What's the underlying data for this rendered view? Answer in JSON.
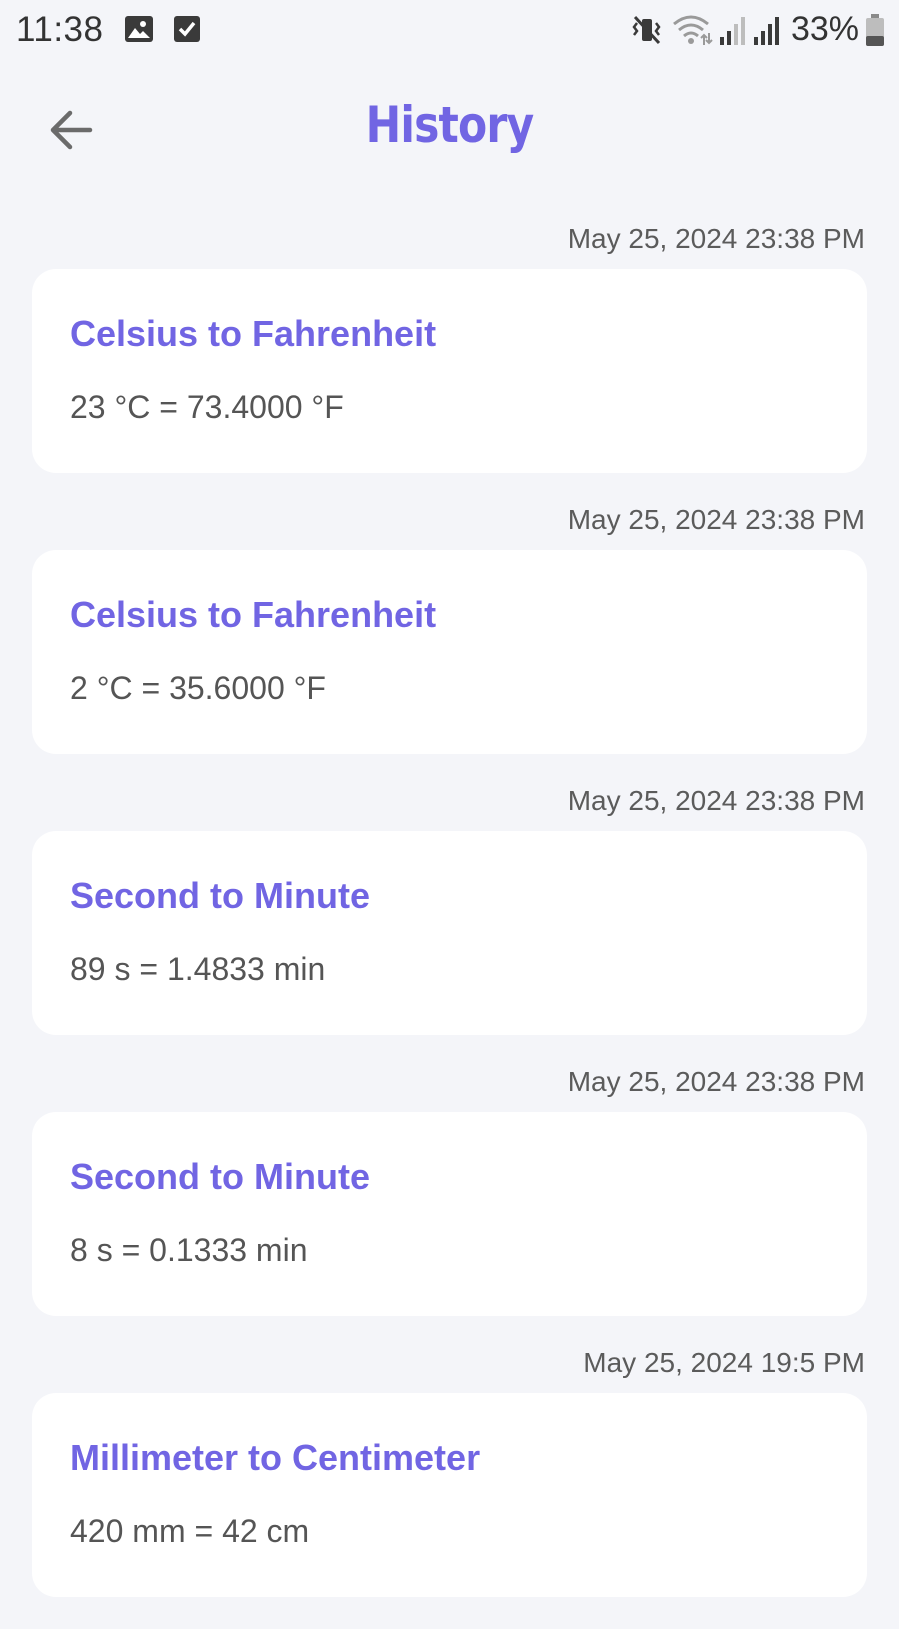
{
  "status_bar": {
    "time": "11:38",
    "battery": "33%",
    "icons": [
      "image-icon",
      "checkbox-icon",
      "vibrate-icon",
      "wifi-icon",
      "signal-icon",
      "signal-icon",
      "battery-icon"
    ]
  },
  "app_bar": {
    "title": "History",
    "back_icon": "arrow-left-icon"
  },
  "colors": {
    "accent": "#7165e3",
    "background": "#f4f5f9",
    "card": "#ffffff",
    "text_secondary": "#555555"
  },
  "history": [
    {
      "date": "May 25, 2024 23:38 PM",
      "title": "Celsius to Fahrenheit",
      "result": "23 °C = 73.4000 °F"
    },
    {
      "date": "May 25, 2024 23:38 PM",
      "title": "Celsius to Fahrenheit",
      "result": "2 °C = 35.6000 °F"
    },
    {
      "date": "May 25, 2024 23:38 PM",
      "title": "Second to Minute",
      "result": "89 s = 1.4833 min"
    },
    {
      "date": "May 25, 2024 23:38 PM",
      "title": "Second to Minute",
      "result": "8 s = 0.1333 min"
    },
    {
      "date": "May 25, 2024 19:5 PM",
      "title": "Millimeter to Centimeter",
      "result": "420 mm = 42 cm"
    }
  ]
}
